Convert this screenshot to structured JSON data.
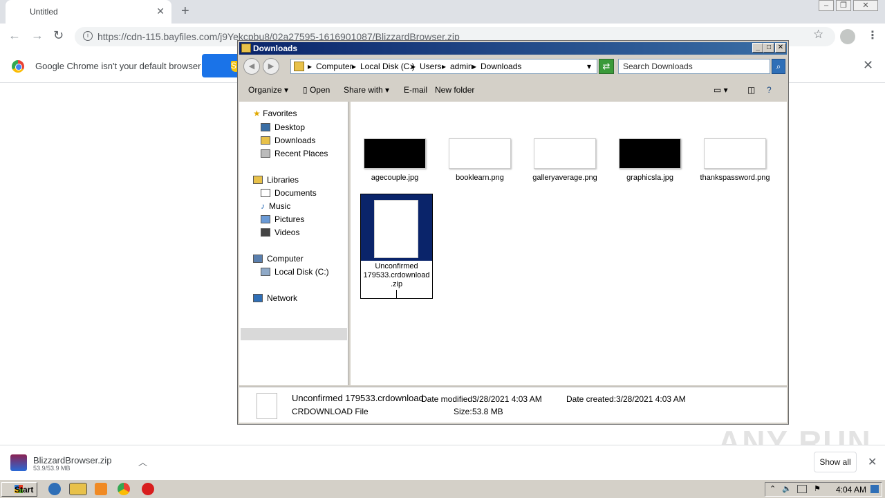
{
  "browser": {
    "tab_title": "Untitled",
    "url": "https://cdn-115.bayfiles.com/j9Yekcpbu8/02a27595-1616901087/BlizzardBrowser.zip",
    "infobar_text": "Google Chrome isn't your default browser",
    "set_default_label": "S"
  },
  "explorer": {
    "title": "Downloads",
    "breadcrumb": [
      "Computer",
      "Local Disk (C:)",
      "Users",
      "admin",
      "Downloads"
    ],
    "search_placeholder": "Search Downloads",
    "commands": {
      "organize": "Organize",
      "open": "Open",
      "share_with": "Share with",
      "email": "E-mail",
      "new_folder": "New folder"
    },
    "nav": {
      "favorites": "Favorites",
      "desktop": "Desktop",
      "downloads": "Downloads",
      "recent_places": "Recent Places",
      "libraries": "Libraries",
      "documents": "Documents",
      "music": "Music",
      "pictures": "Pictures",
      "videos": "Videos",
      "computer": "Computer",
      "local_disk": "Local Disk (C:)",
      "network": "Network"
    },
    "files": [
      {
        "name": "agecouple.jpg",
        "thumb_color": "#000000"
      },
      {
        "name": "booklearn.png",
        "thumb_color": "#ffffff"
      },
      {
        "name": "galleryaverage.png",
        "thumb_color": "#ffffff"
      },
      {
        "name": "graphicsla.jpg",
        "thumb_color": "#000000"
      },
      {
        "name": "thankspassword.png",
        "thumb_color": "#ffffff"
      }
    ],
    "selected_file": {
      "name_line1": "Unconfirmed",
      "name_line2": "179533.crdownload",
      "name_line3": ".zip"
    },
    "details": {
      "name": "Unconfirmed 179533.crdownload",
      "type": "CRDOWNLOAD File",
      "modified_label": "Date modified:",
      "modified_value": "3/28/2021 4:03 AM",
      "created_label": "Date created:",
      "created_value": "3/28/2021 4:03 AM",
      "size_label": "Size:",
      "size_value": "53.8 MB"
    }
  },
  "download_shelf": {
    "file_name": "BlizzardBrowser.zip",
    "progress": "53.9/53.9 MB",
    "show_all": "Show all"
  },
  "watermark": "ANY RUN",
  "taskbar": {
    "start": "Start",
    "clock": "4:04 AM"
  },
  "colors": {
    "chrome_blue": "#1a73e8",
    "selection_blue": "#0a246a",
    "classic_gray": "#d4d0c8"
  }
}
